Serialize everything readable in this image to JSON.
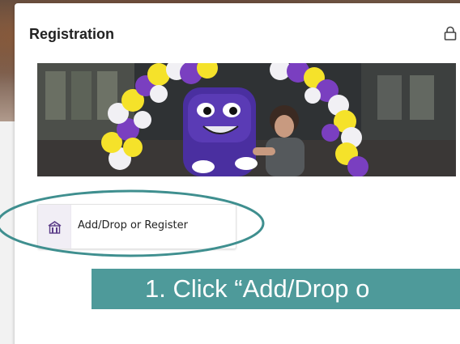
{
  "card": {
    "title": "Registration",
    "lock_icon": "lock-icon"
  },
  "banner": {
    "image": "mascot-photo-with-balloon-arch"
  },
  "quicklink": {
    "icon": "building-icon",
    "label": "Add/Drop or Register"
  },
  "instruction": {
    "text": "1. Click “Add/Drop o"
  },
  "colors": {
    "instruction_bg": "#4e9a9a",
    "highlight_ring": "#3f8f8f",
    "icon_purple": "#5b3c88",
    "balloon_purple": "#7a3fc0",
    "balloon_yellow": "#f5e22a"
  }
}
